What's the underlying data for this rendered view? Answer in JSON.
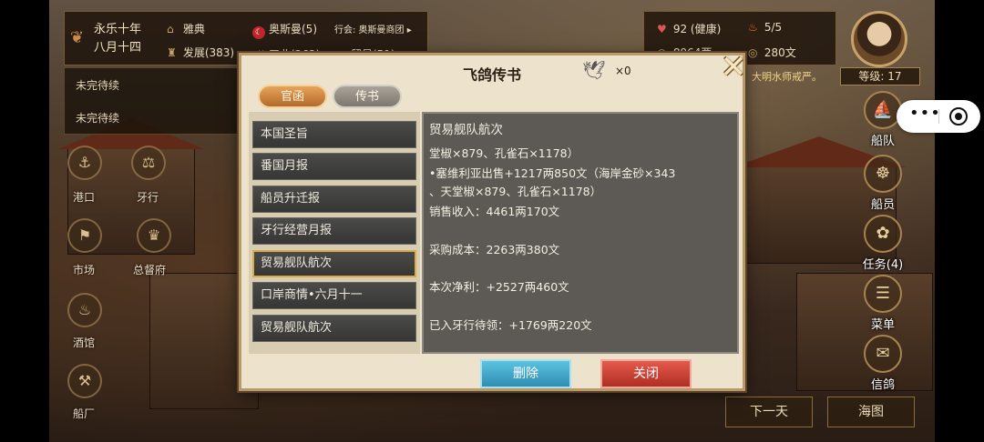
{
  "hud": {
    "date_line1": "永乐十年",
    "date_line2": "八月十四",
    "city": "雅典",
    "development": "发展(383)",
    "nation": "奥斯曼(5)",
    "guild": "行会: 奥斯曼商团",
    "industry": "工业(262)",
    "commerce": "贸易(51)",
    "health": "92 (健康)",
    "ships": "5/5",
    "money": "8964两",
    "copper": "280文",
    "level": "等级: 17",
    "scroll_text": "，大明水师戒严。"
  },
  "quests": [
    "未完待续",
    "未完待续"
  ],
  "nav": {
    "port": "港口",
    "trade": "牙行",
    "market": "市场",
    "governor": "总督府",
    "tavern": "酒馆",
    "shipyard": "船厂"
  },
  "side_nav": [
    "船队",
    "船员",
    "任务(4)",
    "菜单",
    "信鸽"
  ],
  "bottom": {
    "next_day": "下一天",
    "sea_map": "海图"
  },
  "dialog": {
    "title": "飞鸽传书",
    "pigeon_count": "×0",
    "tabs": [
      "官函",
      "传书"
    ],
    "list": [
      "本国圣旨",
      "番国月报",
      "船员升迁报",
      "牙行经营月报",
      "贸易舰队航次",
      "口岸商情•六月十一",
      "贸易舰队航次"
    ],
    "selected_index": 4,
    "content": {
      "heading": "贸易舰队航次",
      "lines": [
        "堂椒×879、孔雀石×1178）",
        "•塞维利亚出售+1217两850文（海岸金砂×343",
        "、天堂椒×879、孔雀石×1178）",
        "销售收入：4461两170文",
        "采购成本：2263两380文",
        "本次净利：+2527两460文",
        "已入牙行待领：+1769两220文"
      ]
    },
    "delete_label": "删除",
    "close_label": "关闭"
  }
}
